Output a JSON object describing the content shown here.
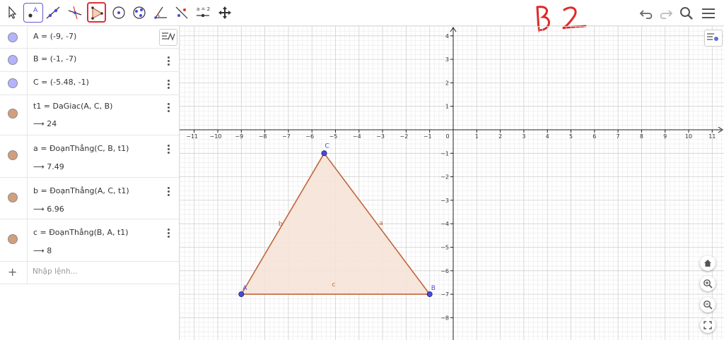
{
  "toolbar": {
    "tools": [
      {
        "name": "move-tool",
        "icon": "arrow-cursor-icon"
      },
      {
        "name": "point-tool",
        "icon": "point-icon",
        "label": "A"
      },
      {
        "name": "line-tool",
        "icon": "line-icon"
      },
      {
        "name": "perpendicular-tool",
        "icon": "perpendicular-line-icon"
      },
      {
        "name": "polygon-tool",
        "icon": "polygon-icon"
      },
      {
        "name": "circle-tool",
        "icon": "circle-center-icon"
      },
      {
        "name": "circle-three-points-tool",
        "icon": "circle-three-points-icon"
      },
      {
        "name": "angle-tool",
        "icon": "angle-icon"
      },
      {
        "name": "reflect-tool",
        "icon": "reflect-line-icon"
      },
      {
        "name": "slider-tool",
        "icon": "slider-icon",
        "label": "a = 2"
      },
      {
        "name": "move-graphics-tool",
        "icon": "move-view-icon"
      }
    ],
    "handwriting": "B 2"
  },
  "algebra": {
    "rows": [
      {
        "color": "#b3b3ff",
        "def": "A = (-9, -7)"
      },
      {
        "color": "#b3b3ff",
        "def": "B = (-1, -7)"
      },
      {
        "color": "#b3b3ff",
        "def": "C = (-5.48, -1)"
      },
      {
        "color": "#d29f7e",
        "def": "t1 = DaGiac(A, C, B)",
        "val": "⟶ 24"
      },
      {
        "color": "#d29f7e",
        "def": "a = ĐoạnThẳng(C, B, t1)",
        "val": "⟶ 7.49"
      },
      {
        "color": "#d29f7e",
        "def": "b = ĐoạnThẳng(A, C, t1)",
        "val": "⟶ 6.96"
      },
      {
        "color": "#d29f7e",
        "def": "c = ĐoạnThẳng(B, A, t1)",
        "val": "⟶ 8"
      }
    ],
    "input_placeholder": "Nhập lệnh..."
  },
  "graph": {
    "x_ticks": [
      -11,
      -10,
      -9,
      -8,
      -7,
      -6,
      -5,
      -4,
      -3,
      -2,
      -1,
      0,
      1,
      2,
      3,
      4,
      5,
      6,
      7,
      8,
      9,
      10,
      11
    ],
    "y_ticks": [
      4,
      3,
      2,
      1,
      -1,
      -2,
      -3,
      -4,
      -5,
      -6,
      -7,
      -8
    ],
    "points": [
      {
        "label": "A",
        "x": -9,
        "y": -7
      },
      {
        "label": "B",
        "x": -1,
        "y": -7
      },
      {
        "label": "C",
        "x": -5.48,
        "y": -1
      }
    ],
    "segments": [
      {
        "label": "a",
        "from": "C",
        "to": "B"
      },
      {
        "label": "b",
        "from": "A",
        "to": "C"
      },
      {
        "label": "c",
        "from": "B",
        "to": "A"
      }
    ],
    "colors": {
      "point": "#4a4ad9",
      "polygon": "#c0653b",
      "fill": "#f5e3d8",
      "grid_major": "#cfcfcf",
      "grid_minor": "#ececec",
      "axis": "#222"
    }
  }
}
